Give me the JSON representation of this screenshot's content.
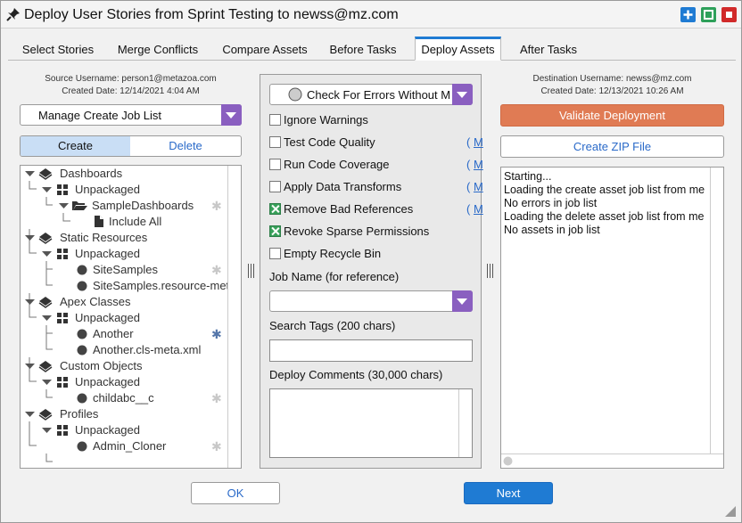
{
  "window": {
    "title": "Deploy User Stories from Sprint Testing to newss@mz.com",
    "controls": [
      {
        "name": "add",
        "color": "#1f7bd3"
      },
      {
        "name": "maximize",
        "color": "#2ea05a"
      },
      {
        "name": "close",
        "color": "#d12a2a"
      }
    ]
  },
  "tabs": [
    {
      "label": "Select Stories",
      "active": false
    },
    {
      "label": "Merge Conflicts",
      "active": false
    },
    {
      "label": "Compare Assets",
      "active": false
    },
    {
      "label": "Before Tasks",
      "active": false
    },
    {
      "label": "Deploy Assets",
      "active": true
    },
    {
      "label": "After Tasks",
      "active": false
    }
  ],
  "source": {
    "username": "Source Username: person1@metazoa.com",
    "created": "Created Date: 12/14/2021 4:04 AM",
    "job_list_select": "Manage Create Job List",
    "segments": {
      "create": "Create",
      "delete": "Delete"
    },
    "tree": {
      "dashboards": "Dashboards",
      "dashboards_folder": "Unpackaged",
      "sample_dashboards": "SampleDashboards",
      "include_all": "Include All",
      "static_resources": "Static Resources",
      "static_folder": "Unpackaged",
      "site_samples": "SiteSamples",
      "site_samples_meta": "SiteSamples.resource-met",
      "apex_classes": "Apex Classes",
      "apex_folder": "Unpackaged",
      "another": "Another",
      "another_meta": "Another.cls-meta.xml",
      "custom_objects": "Custom Objects",
      "objects_folder": "Unpackaged",
      "childabc": "childabc__c",
      "profiles": "Profiles",
      "profiles_folder": "Unpackaged",
      "admin_cloner": "Admin_Cloner"
    }
  },
  "options": {
    "check_select": "Check For Errors Without Making Changes",
    "checkboxes": {
      "ignore_warnings": {
        "label": "Ignore Warnings",
        "checked": false
      },
      "test_code_quality": {
        "label": "Test Code Quality",
        "checked": false,
        "link": "M"
      },
      "run_code_coverage": {
        "label": "Run Code Coverage",
        "checked": false,
        "link": "M"
      },
      "apply_data_transforms": {
        "label": "Apply Data Transforms",
        "checked": false,
        "link": "M"
      },
      "remove_bad_references": {
        "label": "Remove Bad References",
        "checked": true,
        "link": "M"
      },
      "revoke_sparse_permissions": {
        "label": "Revoke Sparse Permissions",
        "checked": true
      },
      "empty_recycle_bin": {
        "label": "Empty Recycle Bin",
        "checked": false
      }
    },
    "link_paren": "(",
    "job_name_label": "Job Name (for reference)",
    "job_name_value": "",
    "search_tags_label": "Search Tags (200 chars)",
    "search_tags_value": "",
    "deploy_comments_label": "Deploy Comments (30,000 chars)",
    "deploy_comments_value": ""
  },
  "destination": {
    "username": "Destination Username: newss@mz.com",
    "created": "Created Date: 12/13/2021 10:26 AM",
    "validate_button": "Validate Deployment",
    "zip_button": "Create ZIP File",
    "log": [
      "Starting...",
      "Loading the create asset job list from me",
      "No errors in job list",
      "Loading the delete asset job list from me",
      "No assets in job list"
    ]
  },
  "footer": {
    "ok": "OK",
    "next": "Next"
  },
  "colors": {
    "accent": "#1f7bd3",
    "validate": "#e07b54",
    "purple": "#8a5fc0",
    "check_green": "#38a05a"
  }
}
